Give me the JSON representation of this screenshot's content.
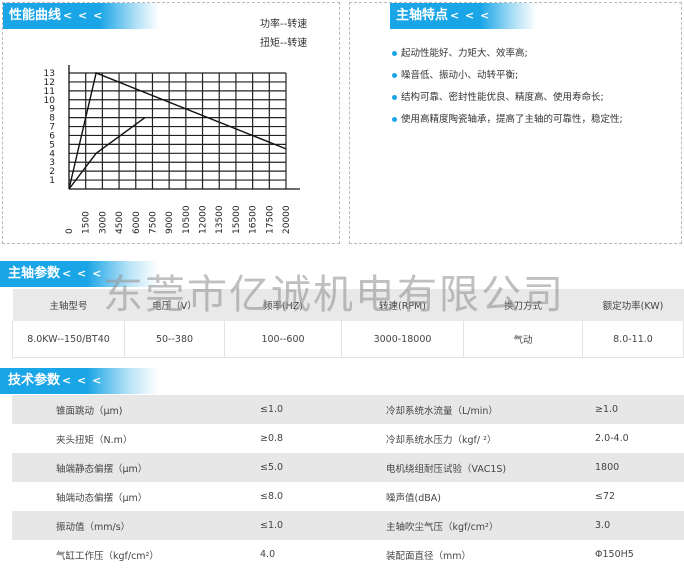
{
  "perf": {
    "title": "性能曲线",
    "arrows": "< < <",
    "legend_power": "功率--转速",
    "legend_torque": "扭矩--转速"
  },
  "chart_data": {
    "type": "line",
    "x_ticks": [
      "0",
      "1500",
      "3000",
      "4500",
      "6000",
      "7500",
      "9000",
      "10500",
      "12000",
      "13500",
      "15000",
      "16500",
      "17500",
      "20000"
    ],
    "y_ticks": [
      1,
      2,
      3,
      4,
      5,
      6,
      7,
      8,
      9,
      10,
      11,
      12,
      13
    ],
    "xlim": [
      0,
      20000
    ],
    "ylim": [
      0,
      13
    ],
    "series": [
      {
        "x": [
          0,
          2500,
          20000
        ],
        "y": [
          0,
          13,
          4.5
        ]
      },
      {
        "x": [
          0,
          2500,
          7000
        ],
        "y": [
          0,
          4,
          8
        ]
      }
    ]
  },
  "features": {
    "title": "主轴特点",
    "arrows": "< < <",
    "items": [
      "起动性能好、力矩大、效率高;",
      "噪音低、振动小、动转平衡;",
      "结构可靠、密封性能优良、精度高、使用寿命长;",
      "使用高精度陶瓷轴承，提高了主轴的可靠性，稳定性;"
    ]
  },
  "spindle": {
    "title": "主轴参数",
    "arrows": "< < <",
    "headers": [
      "主轴型号",
      "电压（V）",
      "频率(HZ)",
      "转速(RPM)",
      "换刀方式",
      "额定功率(KW)"
    ],
    "row": [
      "8.0KW--150/BT40",
      "50--380",
      "100--600",
      "3000-18000",
      "气动",
      "8.0-11.0"
    ]
  },
  "watermark": "东莞市亿诚机电有限公司",
  "tech": {
    "title": "技术参数",
    "arrows": "< < <",
    "rows": [
      [
        "锥面跳动（μm)",
        "≤1.0",
        "冷却系统水流量（L/min）",
        "≥1.0"
      ],
      [
        "夹头扭矩（N.m）",
        "≥0.8",
        "冷却系统水压力（kgf/  ²）",
        "2.0-4.0"
      ],
      [
        "轴端静态偏摆（μm）",
        "≤5.0",
        "电机绕组耐压试验（VAC1S)",
        "1800"
      ],
      [
        "轴端动态偏摆（μm）",
        "≤8.0",
        "噪声值(dBA)",
        "≤72"
      ],
      [
        "振动值（mm/s）",
        "≤1.0",
        "主轴吹尘气压（kgf/cm²）",
        "3.0"
      ],
      [
        "气缸工作压（kgf/cm²）",
        "4.0",
        "装配面直径（mm）",
        "Φ150H5"
      ]
    ]
  }
}
